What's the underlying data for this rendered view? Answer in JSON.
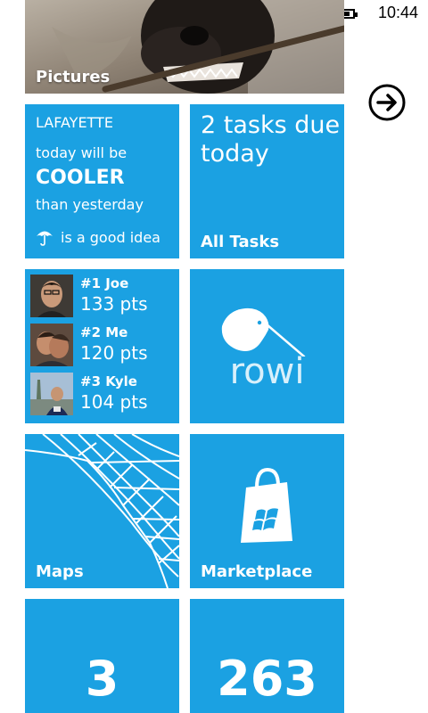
{
  "status_bar": {
    "time": "10:44",
    "battery_icon": "battery-icon"
  },
  "tiles": {
    "pictures": {
      "label": "Pictures"
    },
    "weather": {
      "city": "LAFAYETTE",
      "line1": "today will be",
      "line2": "COOLER",
      "line3": "than yesterday",
      "line4": "is a good idea",
      "icon": "umbrella-icon"
    },
    "tasks": {
      "headline": "2 tasks due today",
      "label": "All Tasks"
    },
    "leaderboard": {
      "rows": [
        {
          "rank": "#1 Joe",
          "points": "133 pts"
        },
        {
          "rank": "#2 Me",
          "points": "120 pts"
        },
        {
          "rank": "#3 Kyle",
          "points": "104 pts"
        }
      ]
    },
    "rowi": {
      "name": "rowi",
      "icon": "kiwi-icon"
    },
    "maps": {
      "label": "Maps"
    },
    "marketplace": {
      "label": "Marketplace",
      "icon": "shopping-bag-icon"
    },
    "counter_left": {
      "value": "3"
    },
    "counter_right": {
      "value": "263"
    }
  },
  "navigation": {
    "arrow_icon": "arrow-right-circle-icon"
  },
  "colors": {
    "accent": "#1ba1e2",
    "background": "#ffffff"
  }
}
